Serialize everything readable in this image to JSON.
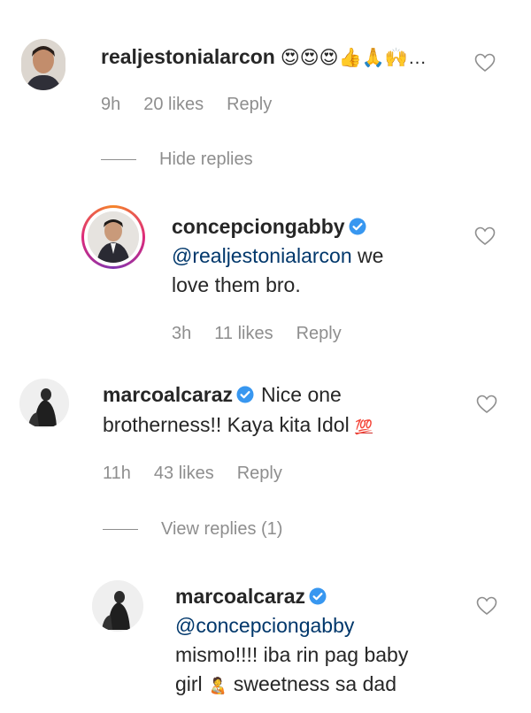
{
  "comments": [
    {
      "username": "realjestonialarcon",
      "text": "😍😍😍👍🙏🙌…",
      "time": "9h",
      "likes": "20 likes",
      "reply": "Reply",
      "toggle": "Hide replies"
    },
    {
      "username": "concepciongabby",
      "mention": "@realjestonialarcon",
      "text_line1": " we",
      "text_line2": "love them bro.",
      "time": "3h",
      "likes": "11 likes",
      "reply": "Reply"
    },
    {
      "username": "marcoalcaraz",
      "text_line1": "Nice one",
      "text_line2": "brotherness!! Kaya kita Idol",
      "hundred": "💯",
      "time": "11h",
      "likes": "43 likes",
      "reply": "Reply",
      "toggle": "View replies (1)"
    },
    {
      "username": "marcoalcaraz",
      "mention": "@concepciongabby",
      "text_line1": "mismo!!!! iba rin pag baby",
      "text_line2_a": "girl",
      "text_line2_b": "sweetness sa dad",
      "emoji": "🧑‍🍼"
    }
  ],
  "colors": {
    "text": "#262626",
    "meta": "#8e8e8e",
    "mention": "#00376b",
    "verified": "#3897f0"
  },
  "icons": {
    "like": "heart-outline-icon",
    "verified": "verified-badge-icon"
  }
}
